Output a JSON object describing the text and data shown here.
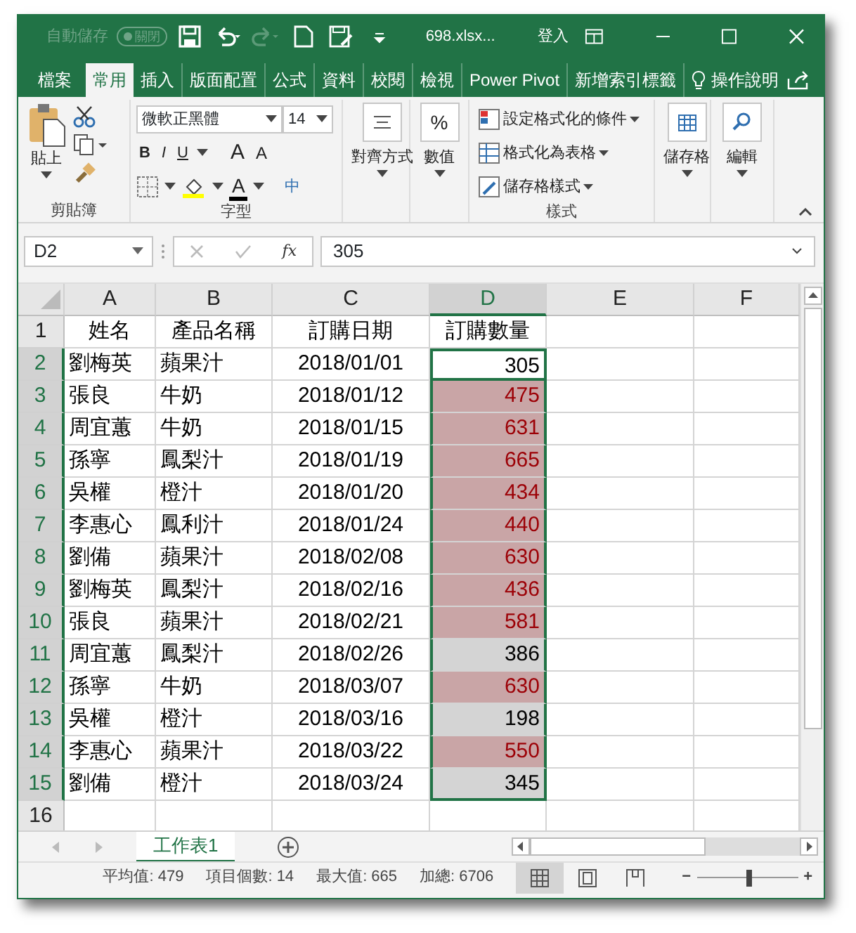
{
  "title_bar": {
    "autosave_label": "自動儲存",
    "autosave_toggle": "關閉",
    "file_name": "698.xlsx...",
    "sign_in": "登入",
    "quick_access": [
      {
        "kind": "save",
        "disabled": false
      },
      {
        "kind": "undo",
        "disabled": false
      },
      {
        "kind": "redo",
        "disabled": true
      },
      {
        "kind": "new",
        "disabled": false
      },
      {
        "kind": "form",
        "disabled": false
      },
      {
        "kind": "customize",
        "disabled": false
      }
    ]
  },
  "ribbon_tabs": [
    {
      "label": "檔案",
      "selected": false
    },
    {
      "label": "常用",
      "selected": true
    },
    {
      "label": "插入",
      "selected": false
    },
    {
      "label": "版面配置",
      "selected": false
    },
    {
      "label": "公式",
      "selected": false
    },
    {
      "label": "資料",
      "selected": false
    },
    {
      "label": "校閱",
      "selected": false
    },
    {
      "label": "檢視",
      "selected": false
    },
    {
      "label": "Power Pivot",
      "selected": false
    },
    {
      "label": "新增索引標籤",
      "selected": false
    }
  ],
  "tell_me": "操作說明",
  "ribbon": {
    "clipboard": {
      "label": "剪貼簿",
      "paste": "貼上"
    },
    "font": {
      "label": "字型",
      "font_name": "微軟正黑體",
      "font_size": "14",
      "style_buttons": [
        "B",
        "I",
        "U"
      ],
      "size_buttons": [
        "A",
        "A"
      ],
      "font_color": "A",
      "phonetic": "中"
    },
    "alignment": "對齊方式",
    "number": {
      "label": "數值",
      "icon_text": "%"
    },
    "styles": {
      "label": "樣式",
      "items": [
        "設定格式化的條件",
        "格式化為表格",
        "儲存格樣式"
      ]
    },
    "cells": "儲存格",
    "editing": "編輯"
  },
  "formula_bar": {
    "name_box": "D2",
    "fx": "fx",
    "value": "305"
  },
  "columns": [
    {
      "label": "A",
      "selected": false
    },
    {
      "label": "B",
      "selected": false
    },
    {
      "label": "C",
      "selected": false
    },
    {
      "label": "D",
      "selected": true
    },
    {
      "label": "E",
      "selected": false
    },
    {
      "label": "F",
      "selected": false
    }
  ],
  "rows": [
    {
      "number": "1",
      "cells": [
        "姓名",
        "產品名稱",
        "訂購日期",
        "訂購數量"
      ],
      "highlight": false,
      "selected": false,
      "active": false
    },
    {
      "number": "2",
      "cells": [
        "劉梅英",
        "蘋果汁",
        "2018/01/01",
        "305"
      ],
      "highlight": false,
      "selected": true,
      "active": true
    },
    {
      "number": "3",
      "cells": [
        "張良",
        "牛奶",
        "2018/01/12",
        "475"
      ],
      "highlight": true,
      "selected": true,
      "active": false
    },
    {
      "number": "4",
      "cells": [
        "周宜蕙",
        "牛奶",
        "2018/01/15",
        "631"
      ],
      "highlight": true,
      "selected": true,
      "active": false
    },
    {
      "number": "5",
      "cells": [
        "孫寧",
        "鳳梨汁",
        "2018/01/19",
        "665"
      ],
      "highlight": true,
      "selected": true,
      "active": false
    },
    {
      "number": "6",
      "cells": [
        "吳權",
        "橙汁",
        "2018/01/20",
        "434"
      ],
      "highlight": true,
      "selected": true,
      "active": false
    },
    {
      "number": "7",
      "cells": [
        "李惠心",
        "鳳利汁",
        "2018/01/24",
        "440"
      ],
      "highlight": true,
      "selected": true,
      "active": false
    },
    {
      "number": "8",
      "cells": [
        "劉備",
        "蘋果汁",
        "2018/02/08",
        "630"
      ],
      "highlight": true,
      "selected": true,
      "active": false
    },
    {
      "number": "9",
      "cells": [
        "劉梅英",
        "鳳梨汁",
        "2018/02/16",
        "436"
      ],
      "highlight": true,
      "selected": true,
      "active": false
    },
    {
      "number": "10",
      "cells": [
        "張良",
        "蘋果汁",
        "2018/02/21",
        "581"
      ],
      "highlight": true,
      "selected": true,
      "active": false
    },
    {
      "number": "11",
      "cells": [
        "周宜蕙",
        "鳳梨汁",
        "2018/02/26",
        "386"
      ],
      "highlight": false,
      "selected": true,
      "active": false
    },
    {
      "number": "12",
      "cells": [
        "孫寧",
        "牛奶",
        "2018/03/07",
        "630"
      ],
      "highlight": true,
      "selected": true,
      "active": false
    },
    {
      "number": "13",
      "cells": [
        "吳權",
        "橙汁",
        "2018/03/16",
        "198"
      ],
      "highlight": false,
      "selected": true,
      "active": false
    },
    {
      "number": "14",
      "cells": [
        "李惠心",
        "蘋果汁",
        "2018/03/22",
        "550"
      ],
      "highlight": true,
      "selected": true,
      "active": false
    },
    {
      "number": "15",
      "cells": [
        "劉備",
        "橙汁",
        "2018/03/24",
        "345"
      ],
      "highlight": false,
      "selected": true,
      "active": false
    },
    {
      "number": "16",
      "cells": [],
      "highlight": false,
      "selected": false,
      "active": false
    }
  ],
  "sheet_tabs": [
    {
      "label": "工作表1",
      "selected": true
    }
  ],
  "status_bar": {
    "stats": [
      "平均值: 479",
      "項目個數: 14",
      "最大值: 665",
      "加總: 6706"
    ],
    "views": [
      {
        "kind": "normal",
        "selected": true
      },
      {
        "kind": "page_layout",
        "selected": false
      },
      {
        "kind": "page_break",
        "selected": false
      }
    ],
    "zoom_out": "−",
    "zoom_in": "+",
    "zoom": {
      "level": 0.52
    }
  }
}
